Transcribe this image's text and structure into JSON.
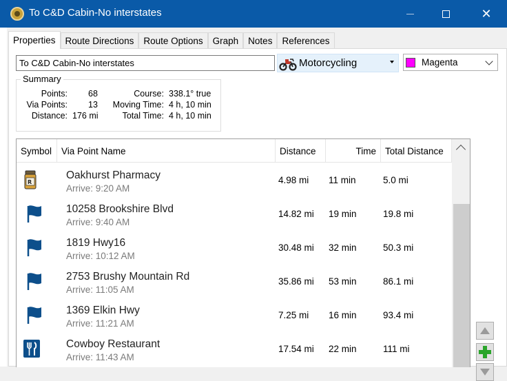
{
  "window": {
    "title": "To C&D Cabin-No interstates"
  },
  "tabs": [
    {
      "label": "Properties",
      "active": true
    },
    {
      "label": "Route Directions"
    },
    {
      "label": "Route Options"
    },
    {
      "label": "Graph"
    },
    {
      "label": "Notes"
    },
    {
      "label": "References"
    }
  ],
  "route": {
    "name": "To C&D Cabin-No interstates",
    "profile": "Motorcycling",
    "color": {
      "label": "Magenta",
      "hex": "#ff00ff"
    }
  },
  "summary": {
    "legend": "Summary",
    "points_label": "Points:",
    "points": "68",
    "via_label": "Via Points:",
    "via": "13",
    "distance_label": "Distance:",
    "distance": "176 mi",
    "course_label": "Course:",
    "course": "338.1° true",
    "moving_label": "Moving Time:",
    "moving": "4 h, 10 min",
    "total_label": "Total Time:",
    "total": "4 h, 10 min"
  },
  "table": {
    "headers": {
      "symbol": "Symbol",
      "name": "Via Point Name",
      "distance": "Distance",
      "time": "Time",
      "total": "Total Distance"
    },
    "rows": [
      {
        "icon": "pharmacy-icon",
        "name": "Oakhurst Pharmacy",
        "arrive": "Arrive: 9:20 AM",
        "distance": "4.98 mi",
        "time": "11 min",
        "total": "5.0 mi"
      },
      {
        "icon": "flag-icon",
        "name": "10258 Brookshire Blvd",
        "arrive": "Arrive: 9:40 AM",
        "distance": "14.82 mi",
        "time": "19 min",
        "total": "19.8 mi"
      },
      {
        "icon": "flag-icon",
        "name": "1819 Hwy16",
        "arrive": "Arrive: 10:12 AM",
        "distance": "30.48 mi",
        "time": "32 min",
        "total": "50.3 mi"
      },
      {
        "icon": "flag-icon",
        "name": "2753 Brushy Mountain Rd",
        "arrive": "Arrive: 11:05 AM",
        "distance": "35.86 mi",
        "time": "53 min",
        "total": "86.1 mi"
      },
      {
        "icon": "flag-icon",
        "name": "1369 Elkin Hwy",
        "arrive": "Arrive: 11:21 AM",
        "distance": "7.25 mi",
        "time": "16 min",
        "total": "93.4 mi"
      },
      {
        "icon": "restaurant-icon",
        "name": "Cowboy Restaurant",
        "arrive": "Arrive: 11:43 AM",
        "distance": "17.54 mi",
        "time": "22 min",
        "total": "111 mi"
      }
    ]
  },
  "colors": {
    "titlebar": "#0a5aa8",
    "flag": "#0d4f8b",
    "add": "#2aa52a"
  }
}
